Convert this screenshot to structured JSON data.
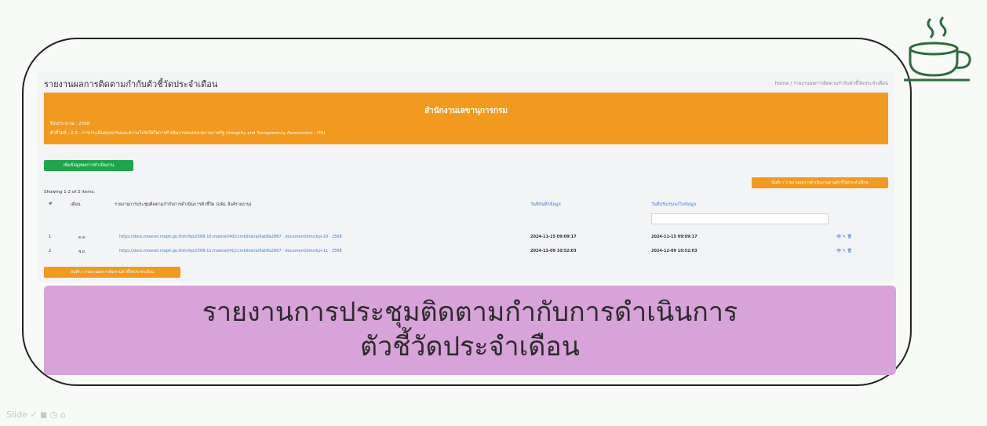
{
  "slide": {
    "caption_line1": "รายงานการประชุมติดตามกำกับการดำเนินการ",
    "caption_line2": "ตัวชี้วัดประจำเดือน",
    "watermark": "Slide ✓ ◼ ◷ ⌂"
  },
  "screenshot": {
    "page_title": "รายงานผลการติดตามกำกับตัวชี้วัดประจำเดือน",
    "breadcrumb": "Home / รายงานผลการติดตามกำกับตัวชี้วัดประจำเดือน",
    "banner": {
      "title": "สำนักงานเลขานุการกรม",
      "line1": "ปีงบประมาณ : 2568",
      "line2": "ตัวชี้วัดที่ : 2.3 - การประเมินคุณธรรมและความโปร่งใสในการดำเนินงานของหน่วยงานภาครัฐ (Integrity and Transparency Assessment : ITA)",
      "color": "#f29a1f"
    },
    "add_button": "เพิ่มข้อมูลผลการดำเนินงาน",
    "right_button": "บันทึก / รายงานผลการดำเนินงานตามตัวชี้วัดประจำเดือน",
    "showing": "Showing 1-2 of 2 items.",
    "table": {
      "headers": [
        "#",
        "เดือน",
        "รายงานการประชุมติดตามกำกับการดำเนินการตัวชี้วัด (URL ลิงค์รายงาน)",
        "วันที่บันทึกข้อมูล",
        "วันที่ปรับปรุงแก้ไขข้อมูล"
      ],
      "rows": [
        {
          "no": "1",
          "month": "ต.ค.",
          "url": "https://docs.moenet.moph.go.th/hr/kpi2568-10.moenet/40/ccmbillok/a/0ab8a2867 · document/dms/kpi-10 · 2568",
          "created": "2024-11-15 09:09:17",
          "updated": "2024-11-15 09:09:17",
          "actions": "👁 ✎ 🗑"
        },
        {
          "no": "2",
          "month": "พ.ย.",
          "url": "https://docs.moenet.moph.go.th/hr/kpi2568-11.moenet/41/ccmbillok/a/0ab8a2867 · document/dms/kpi-11 · 2568",
          "created": "2024-12-09 10:52:03",
          "updated": "2024-12-09 10:52:03",
          "actions": "👁 ✎ 🗑"
        }
      ]
    },
    "bottom_button": "บันทึก / รายงานผลการติดตามตัวชี้วัดประจำเดือน"
  },
  "icons": {
    "coffee": "coffee-cup-icon"
  },
  "colors": {
    "caption_bg": "#d8a3d8",
    "green_button": "#1fa64c",
    "orange": "#f29a1f",
    "link": "#3c7bd6"
  }
}
